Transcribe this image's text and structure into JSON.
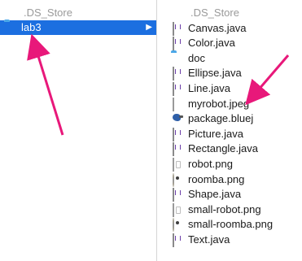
{
  "left_column": {
    "items": [
      {
        "name": ".DS_Store",
        "icon": "doc-icon",
        "dim": true
      },
      {
        "name": "lab3",
        "icon": "folder-icon",
        "selected": true,
        "has_children": true
      }
    ]
  },
  "right_column": {
    "items": [
      {
        "name": ".DS_Store",
        "icon": "doc-icon",
        "dim": true
      },
      {
        "name": "Canvas.java",
        "icon": "java-file-icon"
      },
      {
        "name": "Color.java",
        "icon": "java-file-icon"
      },
      {
        "name": "doc",
        "icon": "folder-icon"
      },
      {
        "name": "Ellipse.java",
        "icon": "java-file-icon"
      },
      {
        "name": "Line.java",
        "icon": "java-file-icon"
      },
      {
        "name": "myrobot.jpeg",
        "icon": "jpeg-file-icon"
      },
      {
        "name": "package.bluej",
        "icon": "bluej-file-icon"
      },
      {
        "name": "Picture.java",
        "icon": "java-file-icon"
      },
      {
        "name": "Rectangle.java",
        "icon": "java-file-icon"
      },
      {
        "name": "robot.png",
        "icon": "png-file-icon"
      },
      {
        "name": "roomba.png",
        "icon": "roomba-png-icon"
      },
      {
        "name": "Shape.java",
        "icon": "java-file-icon"
      },
      {
        "name": "small-robot.png",
        "icon": "png-file-icon"
      },
      {
        "name": "small-roomba.png",
        "icon": "roomba-png-icon"
      },
      {
        "name": "Text.java",
        "icon": "java-file-icon"
      }
    ]
  },
  "colors": {
    "selection": "#1c6fe0",
    "arrow": "#e8187a",
    "folder": "#5fb6ef"
  }
}
